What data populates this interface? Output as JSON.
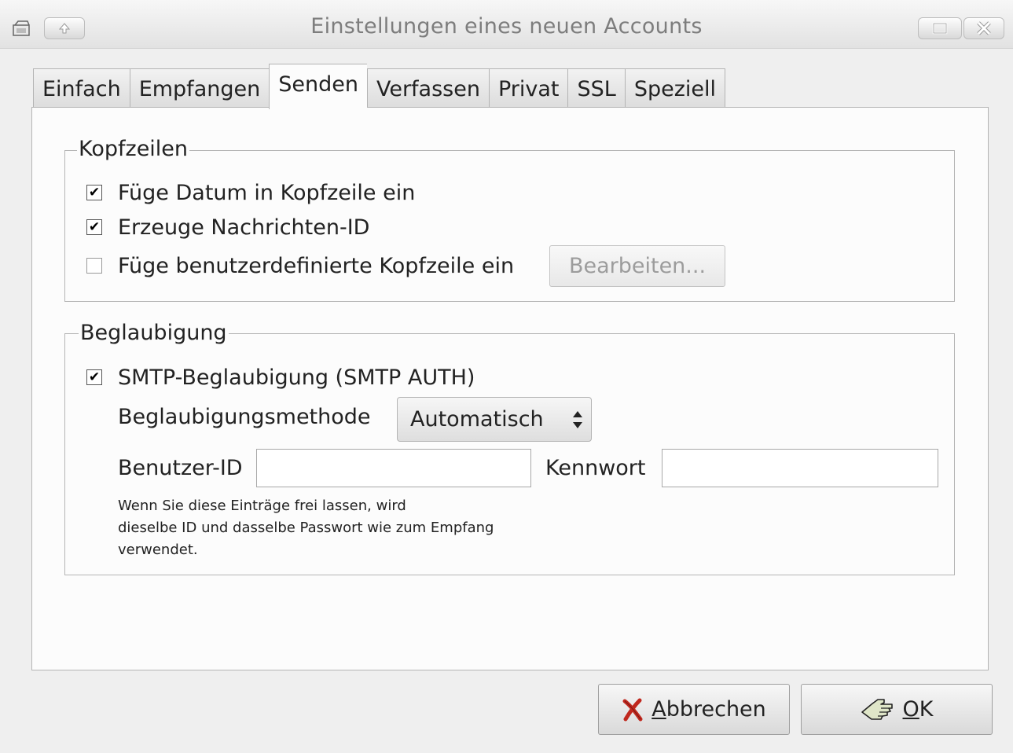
{
  "window": {
    "title": "Einstellungen eines neuen Accounts",
    "icons": [
      "window-menu-icon",
      "shade-up-icon",
      "maximize-icon",
      "close-icon"
    ]
  },
  "tabs": [
    {
      "label": "Einfach",
      "active": false
    },
    {
      "label": "Empfangen",
      "active": false
    },
    {
      "label": "Senden",
      "active": true
    },
    {
      "label": "Verfassen",
      "active": false
    },
    {
      "label": "Privat",
      "active": false
    },
    {
      "label": "SSL",
      "active": false
    },
    {
      "label": "Speziell",
      "active": false
    }
  ],
  "headers_group": {
    "legend": "Kopfzeilen",
    "add_date": {
      "label": "Füge Datum in Kopfzeile ein",
      "checked": true
    },
    "gen_msgid": {
      "label": "Erzeuge Nachrichten-ID",
      "checked": true
    },
    "custom_header": {
      "label": "Füge benutzerdefinierte Kopfzeile ein",
      "checked": false
    },
    "edit_button": "Bearbeiten..."
  },
  "auth_group": {
    "legend": "Beglaubigung",
    "smtp_auth": {
      "label": "SMTP-Beglaubigung (SMTP AUTH)",
      "checked": true
    },
    "method_label": "Beglaubigungsmethode",
    "method_value": "Automatisch",
    "user_label": "Benutzer-ID",
    "user_value": "",
    "password_label": "Kennwort",
    "password_value": "",
    "hint_lines": [
      "Wenn Sie diese Einträge frei lassen, wird",
      "dieselbe ID und dasselbe Passwort wie zum Empfang",
      "verwendet."
    ]
  },
  "buttons": {
    "cancel_mnemonic": "A",
    "cancel_rest": "bbrechen",
    "ok_mnemonic": "O",
    "ok_rest": "K"
  },
  "colors": {
    "cancel_icon": "#c0281e",
    "ok_icon": "#6a8e3a"
  }
}
